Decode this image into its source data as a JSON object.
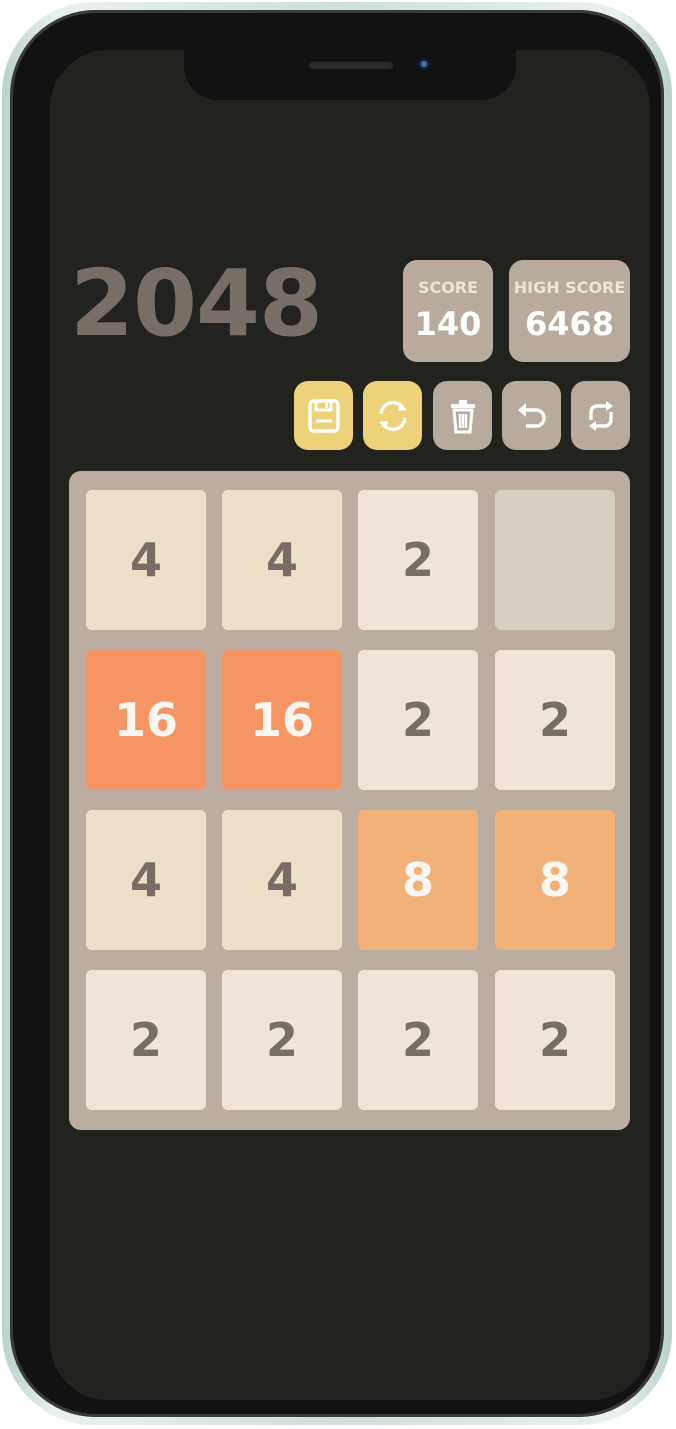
{
  "game": {
    "title": "2048",
    "score": {
      "label": "SCORE",
      "value": "140"
    },
    "high_score": {
      "label": "HIGH SCORE",
      "value": "6468"
    }
  },
  "controls": [
    {
      "name": "save-button",
      "icon": "save-icon",
      "color": "#edd27a"
    },
    {
      "name": "load-button",
      "icon": "sync-icon",
      "color": "#edd27a"
    },
    {
      "name": "delete-button",
      "icon": "trash-icon",
      "color": "#b8aa9c"
    },
    {
      "name": "undo-button",
      "icon": "undo-icon",
      "color": "#b8aa9c"
    },
    {
      "name": "restart-button",
      "icon": "refresh-icon",
      "color": "#b8aa9c"
    }
  ],
  "board": {
    "rows": [
      [
        "4",
        "4",
        "2",
        ""
      ],
      [
        "16",
        "16",
        "2",
        "2"
      ],
      [
        "4",
        "4",
        "8",
        "8"
      ],
      [
        "2",
        "2",
        "2",
        "2"
      ]
    ]
  },
  "tile_colors": {
    "empty": {
      "bg": "#d6cdc3",
      "fg": "#776e65"
    },
    "2": {
      "bg": "#eee4da",
      "fg": "#776e65"
    },
    "4": {
      "bg": "#ede0c8",
      "fg": "#776e65"
    },
    "8": {
      "bg": "#f2b179",
      "fg": "#f9f6f2"
    },
    "16": {
      "bg": "#f59563",
      "fg": "#f9f6f2"
    }
  }
}
